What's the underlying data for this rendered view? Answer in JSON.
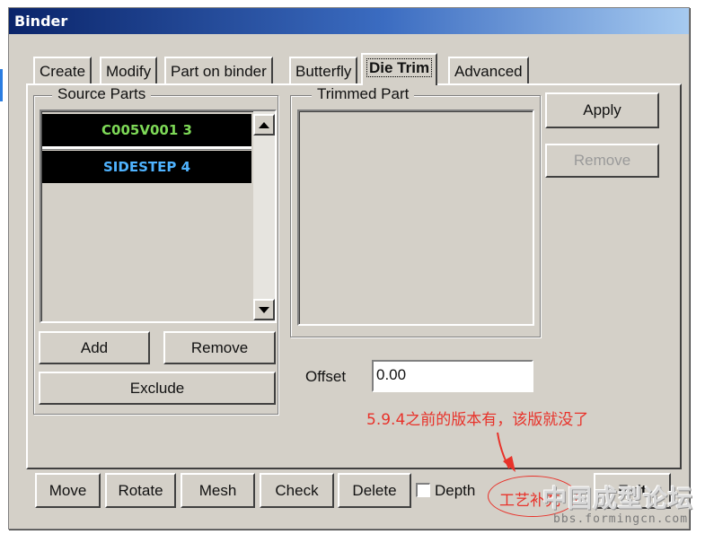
{
  "window": {
    "title": "Binder"
  },
  "tabs": [
    {
      "label": "Create"
    },
    {
      "label": "Modify"
    },
    {
      "label": "Part on binder"
    },
    {
      "label": "Butterfly"
    },
    {
      "label": "Die Trim",
      "active": true
    },
    {
      "label": "Advanced"
    }
  ],
  "source_parts": {
    "legend": "Source Parts",
    "items": [
      {
        "label": "C005V001  3",
        "color": "#7ed957"
      },
      {
        "label": "SIDESTEP  4",
        "color": "#4fb3ff"
      }
    ],
    "scroll_up_icon": "triangle-up",
    "scroll_down_icon": "triangle-down",
    "add_label": "Add",
    "remove_label": "Remove",
    "exclude_label": "Exclude"
  },
  "trimmed_part": {
    "legend": "Trimmed Part"
  },
  "side_buttons": {
    "apply_label": "Apply",
    "remove_label": "Remove"
  },
  "offset": {
    "label": "Offset",
    "value": "0.00"
  },
  "bottom_bar": {
    "move_label": "Move",
    "rotate_label": "Rotate",
    "mesh_label": "Mesh",
    "check_label": "Check",
    "delete_label": "Delete",
    "depth_label": "Depth",
    "depth_checked": false,
    "exit_label": "Exit"
  },
  "annotations": {
    "note": "5.9.4之前的版本有，该版就没了",
    "circled_label": "工艺补充",
    "color": "#e8322a"
  },
  "watermark": {
    "title": "中国成型论坛",
    "url": "bbs.formingcn.com"
  }
}
